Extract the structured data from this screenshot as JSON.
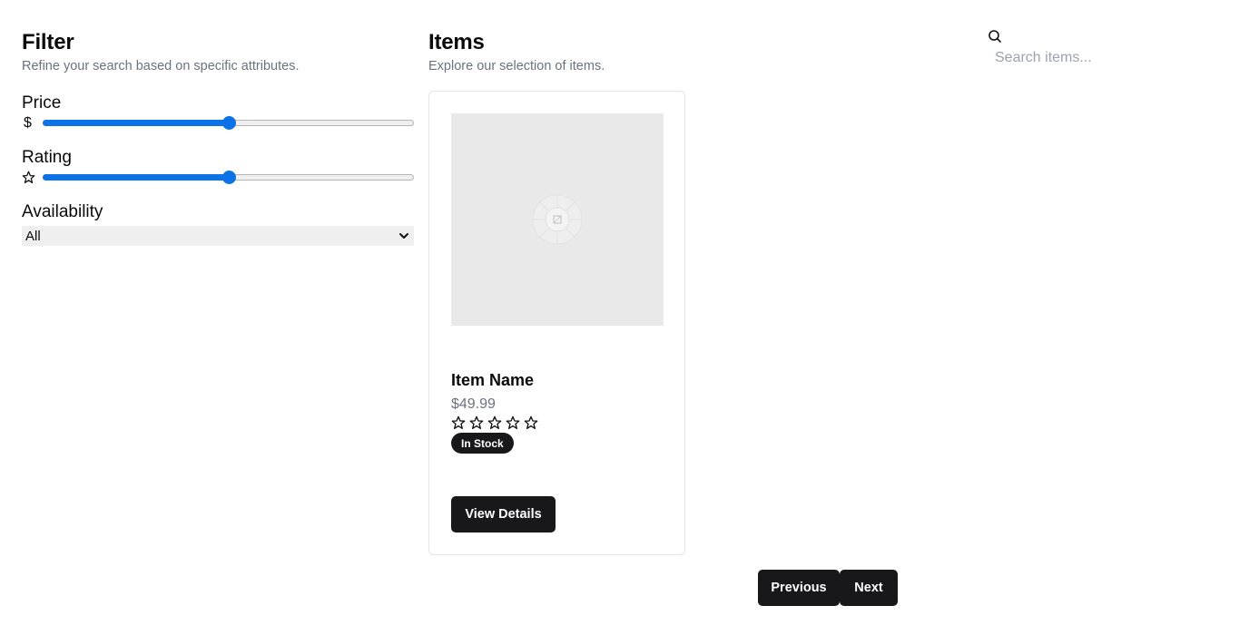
{
  "filter": {
    "title": "Filter",
    "subtitle": "Refine your search based on specific attributes.",
    "price": {
      "label": "Price",
      "icon": "dollar-icon",
      "value_fraction": 0.5
    },
    "rating": {
      "label": "Rating",
      "icon": "star-icon",
      "value_fraction": 0.5
    },
    "availability": {
      "label": "Availability",
      "selected": "All"
    }
  },
  "items": {
    "title": "Items",
    "subtitle": "Explore our selection of items.",
    "cards": [
      {
        "name": "Item Name",
        "price": "$49.99",
        "rating_stars": 0,
        "rating_max": 5,
        "badge": "In Stock",
        "button_label": "View Details"
      }
    ]
  },
  "search": {
    "placeholder": "Search items...",
    "icon": "search-icon"
  },
  "pagination": {
    "previous_label": "Previous",
    "next_label": "Next"
  },
  "colors": {
    "accent": "#0b72e7",
    "primary": "#18181b",
    "muted": "#6b7280"
  }
}
